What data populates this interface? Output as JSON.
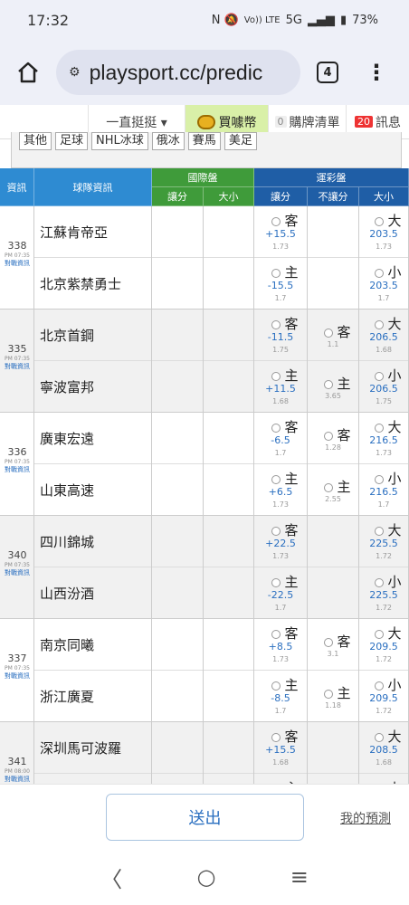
{
  "status": {
    "time": "17:32",
    "icons": "N 🔕",
    "volte": "Vo)) LTE",
    "network": "5G",
    "battery": "73%"
  },
  "browser": {
    "url": "playsport.cc/predic",
    "tab_count": "4"
  },
  "site_nav": {
    "follow": "一直挺挺 ▾",
    "buy": "買噱幣",
    "cart_count": "0",
    "cart": "購牌清單",
    "msg_count": "20",
    "msg": "訊息"
  },
  "sports": [
    "其他",
    "足球",
    "NHL冰球",
    "俄冰",
    "賽馬",
    "美足"
  ],
  "header": {
    "info": "資訊",
    "teams": "球隊資訊",
    "intl": "國際盤",
    "intl_handicap": "讓分",
    "intl_total": "大小",
    "lottery": "運彩盤",
    "lottery_handicap": "讓分",
    "lottery_nohandicap": "不讓分",
    "lottery_total": "大小"
  },
  "matches": [
    {
      "id": "338",
      "time": "PM 07:35",
      "link": "對戰資訊",
      "away": {
        "team": "江蘇肯帝亞",
        "hc_pick": "客",
        "hc_line": "+15.5",
        "hc_odd": "1.73",
        "ml_pick": "",
        "ml_odd": "",
        "tot_pick": "大",
        "tot_line": "203.5",
        "tot_odd": "1.73"
      },
      "home": {
        "team": "北京紫禁勇士",
        "hc_pick": "主",
        "hc_line": "-15.5",
        "hc_odd": "1.7",
        "ml_pick": "",
        "ml_odd": "",
        "tot_pick": "小",
        "tot_line": "203.5",
        "tot_odd": "1.7"
      }
    },
    {
      "id": "335",
      "time": "PM 07:35",
      "link": "對戰資訊",
      "away": {
        "team": "北京首鋼",
        "hc_pick": "客",
        "hc_line": "-11.5",
        "hc_odd": "1.75",
        "ml_pick": "客",
        "ml_odd": "1.1",
        "tot_pick": "大",
        "tot_line": "206.5",
        "tot_odd": "1.68"
      },
      "home": {
        "team": "寧波富邦",
        "hc_pick": "主",
        "hc_line": "+11.5",
        "hc_odd": "1.68",
        "ml_pick": "主",
        "ml_odd": "3.65",
        "tot_pick": "小",
        "tot_line": "206.5",
        "tot_odd": "1.75"
      }
    },
    {
      "id": "336",
      "time": "PM 07:35",
      "link": "對戰資訊",
      "away": {
        "team": "廣東宏遠",
        "hc_pick": "客",
        "hc_line": "-6.5",
        "hc_odd": "1.7",
        "ml_pick": "客",
        "ml_odd": "1.28",
        "tot_pick": "大",
        "tot_line": "216.5",
        "tot_odd": "1.73"
      },
      "home": {
        "team": "山東高速",
        "hc_pick": "主",
        "hc_line": "+6.5",
        "hc_odd": "1.73",
        "ml_pick": "主",
        "ml_odd": "2.55",
        "tot_pick": "小",
        "tot_line": "216.5",
        "tot_odd": "1.7"
      }
    },
    {
      "id": "340",
      "time": "PM 07:35",
      "link": "對戰資訊",
      "away": {
        "team": "四川錦城",
        "hc_pick": "客",
        "hc_line": "+22.5",
        "hc_odd": "1.73",
        "ml_pick": "",
        "ml_odd": "",
        "tot_pick": "大",
        "tot_line": "225.5",
        "tot_odd": "1.72"
      },
      "home": {
        "team": "山西汾酒",
        "hc_pick": "主",
        "hc_line": "-22.5",
        "hc_odd": "1.7",
        "ml_pick": "",
        "ml_odd": "",
        "tot_pick": "小",
        "tot_line": "225.5",
        "tot_odd": "1.72"
      }
    },
    {
      "id": "337",
      "time": "PM 07:35",
      "link": "對戰資訊",
      "away": {
        "team": "南京同曦",
        "hc_pick": "客",
        "hc_line": "+8.5",
        "hc_odd": "1.73",
        "ml_pick": "客",
        "ml_odd": "3.1",
        "tot_pick": "大",
        "tot_line": "209.5",
        "tot_odd": "1.72"
      },
      "home": {
        "team": "浙江廣夏",
        "hc_pick": "主",
        "hc_line": "-8.5",
        "hc_odd": "1.7",
        "ml_pick": "主",
        "ml_odd": "1.18",
        "tot_pick": "小",
        "tot_line": "209.5",
        "tot_odd": "1.72"
      }
    },
    {
      "id": "341",
      "time": "PM 08:00",
      "link": "對戰資訊",
      "away": {
        "team": "深圳馬可波羅",
        "hc_pick": "客",
        "hc_line": "+15.5",
        "hc_odd": "1.68",
        "ml_pick": "",
        "ml_odd": "",
        "tot_pick": "大",
        "tot_line": "208.5",
        "tot_odd": "1.68"
      },
      "home": {
        "team": "",
        "hc_pick": "主",
        "hc_line": "",
        "hc_odd": "",
        "ml_pick": "",
        "ml_odd": "",
        "tot_pick": "小",
        "tot_line": "",
        "tot_odd": ""
      }
    }
  ],
  "footer": {
    "submit": "送出",
    "my_predictions": "我的預測"
  },
  "navbar": {
    "back": "〈",
    "home": "○",
    "recent": "≡"
  }
}
